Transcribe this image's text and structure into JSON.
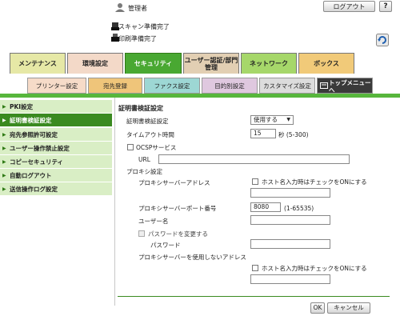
{
  "header": {
    "user_label": "管理者",
    "logout_label": "ログアウト",
    "help_label": "?",
    "status_scan": "スキャン準備完了",
    "status_print": "印刷準備完了"
  },
  "main_tabs": [
    {
      "label": "メンテナンス",
      "color": "#e6e8a6"
    },
    {
      "label": "環境設定",
      "color": "#f3d9c8"
    },
    {
      "label": "セキュリティ",
      "color": "#49a832"
    },
    {
      "label": "ユーザー認証/部門管理",
      "color": "#e2cfb3"
    },
    {
      "label": "ネットワーク",
      "color": "#a6d76a"
    },
    {
      "label": "ボックス",
      "color": "#f1ca79"
    }
  ],
  "sub_tabs": [
    {
      "label": "プリンター設定",
      "color": "#f6dbc8"
    },
    {
      "label": "宛先登録",
      "color": "#efc57a"
    },
    {
      "label": "ファクス設定",
      "color": "#9dd7d4"
    },
    {
      "label": "目的別設定",
      "color": "#dfc8df"
    },
    {
      "label": "カスタマイズ設定",
      "color": "#dcdcdc"
    },
    {
      "label": "トップメニューへ",
      "color": "#3a3a3a"
    }
  ],
  "sidebar": {
    "items": [
      {
        "label": "PKI設定"
      },
      {
        "label": "証明書検証設定"
      },
      {
        "label": "宛先参照許可設定"
      },
      {
        "label": "ユーザー操作禁止設定"
      },
      {
        "label": "コピーセキュリティ"
      },
      {
        "label": "自動ログアウト"
      },
      {
        "label": "送信操作ログ設定"
      }
    ]
  },
  "form": {
    "section_title": "証明書検証設定",
    "verify_label": "証明書検証設定",
    "verify_value": "使用する",
    "timeout_label": "タイムアウト時間",
    "timeout_value": "15",
    "timeout_unit": "秒 (5-300)",
    "ocsp_label": "OCSPサービス",
    "url_label": "URL",
    "url_value": "",
    "proxy_label": "プロキシ設定",
    "proxy_address_label": "プロキシサーバーアドレス",
    "host_check_label": "ホスト名入力時はチェックをONにする",
    "proxy_address_value": "",
    "proxy_port_label": "プロキシサーバーポート番号",
    "proxy_port_value": "8080",
    "proxy_port_range": "(1-65535)",
    "username_label": "ユーザー名",
    "username_value": "",
    "change_password_label": "パスワードを変更する",
    "password_label": "パスワード",
    "password_value": "",
    "no_proxy_label": "プロキシサーバーを使用しないアドレス",
    "host_check_label2": "ホスト名入力時はチェックをONにする",
    "no_proxy_value": "",
    "ok_label": "OK",
    "cancel_label": "キャンセル"
  }
}
